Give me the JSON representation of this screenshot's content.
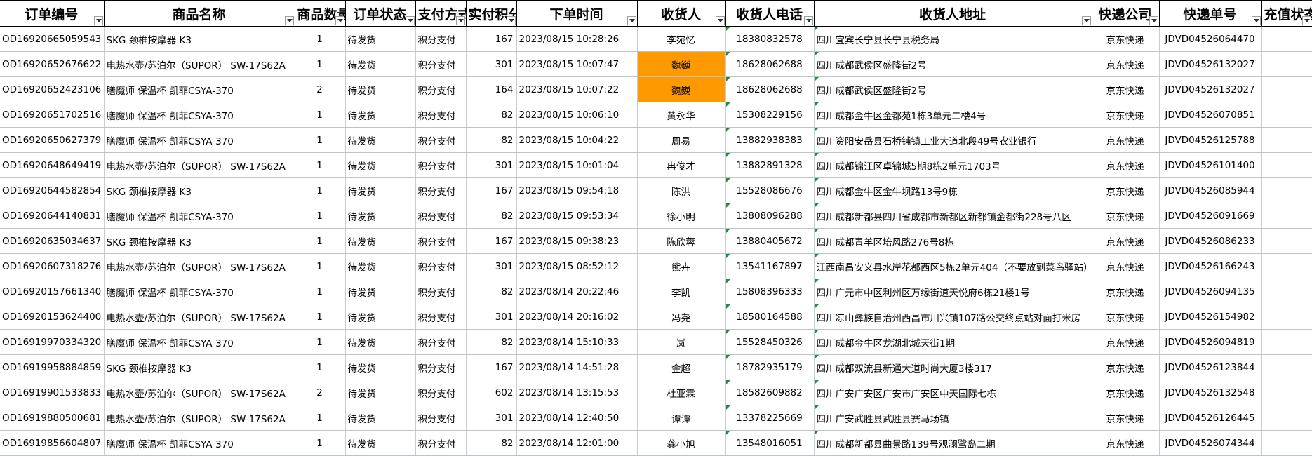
{
  "columns": [
    {
      "key": "order_id",
      "label": "订单编号"
    },
    {
      "key": "product",
      "label": "商品名称"
    },
    {
      "key": "qty",
      "label": "商品数量"
    },
    {
      "key": "status",
      "label": "订单状态"
    },
    {
      "key": "payment",
      "label": "支付方式"
    },
    {
      "key": "points",
      "label": "实付积分"
    },
    {
      "key": "time",
      "label": "下单时间"
    },
    {
      "key": "receiver",
      "label": "收货人"
    },
    {
      "key": "phone",
      "label": "收货人电话"
    },
    {
      "key": "address",
      "label": "收货人地址"
    },
    {
      "key": "courier",
      "label": "快递公司"
    },
    {
      "key": "tracking",
      "label": "快递单号"
    },
    {
      "key": "recharge",
      "label": "充值状态"
    }
  ],
  "rows": [
    {
      "order_id": "OD16920665059543",
      "product": "SKG 颈椎按摩器 K3",
      "qty": "1",
      "status": "待发货",
      "payment": "积分支付",
      "points": "167",
      "time": "2023/08/15 10:28:26",
      "receiver": "李宛忆",
      "phone": "18380832578",
      "address": "四川宜宾长宁县长宁县税务局",
      "courier": "京东快递",
      "tracking": "JDVD04526064470",
      "recharge": ""
    },
    {
      "order_id": "OD16920652676622",
      "product": "电热水壶/苏泊尔（SUPOR） SW-17S62A",
      "qty": "1",
      "status": "待发货",
      "payment": "积分支付",
      "points": "301",
      "time": "2023/08/15 10:07:47",
      "receiver": "魏巍",
      "phone": "18628062688",
      "address": "四川成都武侯区盛隆街2号",
      "courier": "京东快递",
      "tracking": "JDVD04526132027",
      "recharge": "",
      "highlight": true
    },
    {
      "order_id": "OD16920652423106",
      "product": "膳魔师 保温杯 凯菲CSYA-370",
      "qty": "2",
      "status": "待发货",
      "payment": "积分支付",
      "points": "164",
      "time": "2023/08/15 10:07:22",
      "receiver": "魏巍",
      "phone": "18628062688",
      "address": "四川成都武侯区盛隆街2号",
      "courier": "京东快递",
      "tracking": "JDVD04526132027",
      "recharge": "",
      "highlight": true
    },
    {
      "order_id": "OD16920651702516",
      "product": "膳魔师 保温杯 凯菲CSYA-370",
      "qty": "1",
      "status": "待发货",
      "payment": "积分支付",
      "points": "82",
      "time": "2023/08/15 10:06:10",
      "receiver": "黄永华",
      "phone": "15308229156",
      "address": "四川成都金牛区金都苑1栋3单元二楼4号",
      "courier": "京东快递",
      "tracking": "JDVD04526070851",
      "recharge": ""
    },
    {
      "order_id": "OD16920650627379",
      "product": "膳魔师 保温杯 凯菲CSYA-370",
      "qty": "1",
      "status": "待发货",
      "payment": "积分支付",
      "points": "82",
      "time": "2023/08/15 10:04:22",
      "receiver": "周易",
      "phone": "13882938383",
      "address": "四川资阳安岳县石桥铺镇工业大道北段49号农业银行",
      "courier": "京东快递",
      "tracking": "JDVD04526125788",
      "recharge": ""
    },
    {
      "order_id": "OD16920648649419",
      "product": "电热水壶/苏泊尔（SUPOR） SW-17S62A",
      "qty": "1",
      "status": "待发货",
      "payment": "积分支付",
      "points": "301",
      "time": "2023/08/15 10:01:04",
      "receiver": "冉俊才",
      "phone": "13882891328",
      "address": "四川成都锦江区卓锦城5期8栋2单元1703号",
      "courier": "京东快递",
      "tracking": "JDVD04526101400",
      "recharge": ""
    },
    {
      "order_id": "OD16920644582854",
      "product": "SKG 颈椎按摩器 K3",
      "qty": "1",
      "status": "待发货",
      "payment": "积分支付",
      "points": "167",
      "time": "2023/08/15 09:54:18",
      "receiver": "陈洪",
      "phone": "15528086676",
      "address": "四川成都金牛区金牛坝路13号9栋",
      "courier": "京东快递",
      "tracking": "JDVD04526085944",
      "recharge": ""
    },
    {
      "order_id": "OD16920644140831",
      "product": "膳魔师 保温杯 凯菲CSYA-370",
      "qty": "1",
      "status": "待发货",
      "payment": "积分支付",
      "points": "82",
      "time": "2023/08/15 09:53:34",
      "receiver": "徐小明",
      "phone": "13808096288",
      "address": "四川成都新都县四川省成都市新都区新都镇金都街228号八区",
      "courier": "京东快递",
      "tracking": "JDVD04526091669",
      "recharge": ""
    },
    {
      "order_id": "OD16920635034637",
      "product": "SKG 颈椎按摩器 K3",
      "qty": "1",
      "status": "待发货",
      "payment": "积分支付",
      "points": "167",
      "time": "2023/08/15 09:38:23",
      "receiver": "陈欣蓉",
      "phone": "13880405672",
      "address": "四川成都青羊区培风路276号8栋",
      "courier": "京东快递",
      "tracking": "JDVD04526086233",
      "recharge": ""
    },
    {
      "order_id": "OD16920607318276",
      "product": "电热水壶/苏泊尔（SUPOR） SW-17S62A",
      "qty": "1",
      "status": "待发货",
      "payment": "积分支付",
      "points": "301",
      "time": "2023/08/15 08:52:12",
      "receiver": "熊卉",
      "phone": "13541167897",
      "address": "江西南昌安义县水岸花都西区5栋2单元404（不要放到菜鸟驿站）",
      "courier": "京东快递",
      "tracking": "JDVD04526166243",
      "recharge": ""
    },
    {
      "order_id": "OD16920157661340",
      "product": "膳魔师 保温杯 凯菲CSYA-370",
      "qty": "1",
      "status": "待发货",
      "payment": "积分支付",
      "points": "82",
      "time": "2023/08/14 20:22:46",
      "receiver": "李凯",
      "phone": "15808396333",
      "address": "四川广元市中区利州区万缘街道天悦府6栋21楼1号",
      "courier": "京东快递",
      "tracking": "JDVD04526094135",
      "recharge": ""
    },
    {
      "order_id": "OD16920153624400",
      "product": "电热水壶/苏泊尔（SUPOR） SW-17S62A",
      "qty": "1",
      "status": "待发货",
      "payment": "积分支付",
      "points": "301",
      "time": "2023/08/14 20:16:02",
      "receiver": "冯尧",
      "phone": "18580164588",
      "address": "四川凉山彝族自治州西昌市川兴镇107路公交终点站对面打米房",
      "courier": "京东快递",
      "tracking": "JDVD04526154982",
      "recharge": ""
    },
    {
      "order_id": "OD16919970334320",
      "product": "膳魔师 保温杯 凯菲CSYA-370",
      "qty": "1",
      "status": "待发货",
      "payment": "积分支付",
      "points": "82",
      "time": "2023/08/14 15:10:33",
      "receiver": "岚",
      "phone": "15528450326",
      "address": "四川成都金牛区龙湖北城天街1期",
      "courier": "京东快递",
      "tracking": "JDVD04526094819",
      "recharge": ""
    },
    {
      "order_id": "OD16919958884859",
      "product": "SKG 颈椎按摩器 K3",
      "qty": "1",
      "status": "待发货",
      "payment": "积分支付",
      "points": "167",
      "time": "2023/08/14 14:51:28",
      "receiver": "金超",
      "phone": "18782935179",
      "address": "四川成都双流县新通大道时尚大厦3楼317",
      "courier": "京东快递",
      "tracking": "JDVD04526123844",
      "recharge": ""
    },
    {
      "order_id": "OD16919901533833",
      "product": "电热水壶/苏泊尔（SUPOR） SW-17S62A",
      "qty": "2",
      "status": "待发货",
      "payment": "积分支付",
      "points": "602",
      "time": "2023/08/14 13:15:53",
      "receiver": "杜亚霖",
      "phone": "18582609882",
      "address": "四川广安广安区广安市广安区中天国际七栋",
      "courier": "京东快递",
      "tracking": "JDVD04526132548",
      "recharge": ""
    },
    {
      "order_id": "OD16919880500681",
      "product": "电热水壶/苏泊尔（SUPOR） SW-17S62A",
      "qty": "1",
      "status": "待发货",
      "payment": "积分支付",
      "points": "301",
      "time": "2023/08/14 12:40:50",
      "receiver": "谭谭",
      "phone": "13378225669",
      "address": "四川广安武胜县武胜县赛马场镇",
      "courier": "京东快递",
      "tracking": "JDVD04526126445",
      "recharge": ""
    },
    {
      "order_id": "OD16919856604807",
      "product": "膳魔师 保温杯 凯菲CSYA-370",
      "qty": "1",
      "status": "待发货",
      "payment": "积分支付",
      "points": "82",
      "time": "2023/08/14 12:01:00",
      "receiver": "龚小旭",
      "phone": "13548016051",
      "address": "四川成都新都县曲景路139号观澜鹭岛二期",
      "courier": "京东快递",
      "tracking": "JDVD04526074344",
      "recharge": ""
    }
  ]
}
